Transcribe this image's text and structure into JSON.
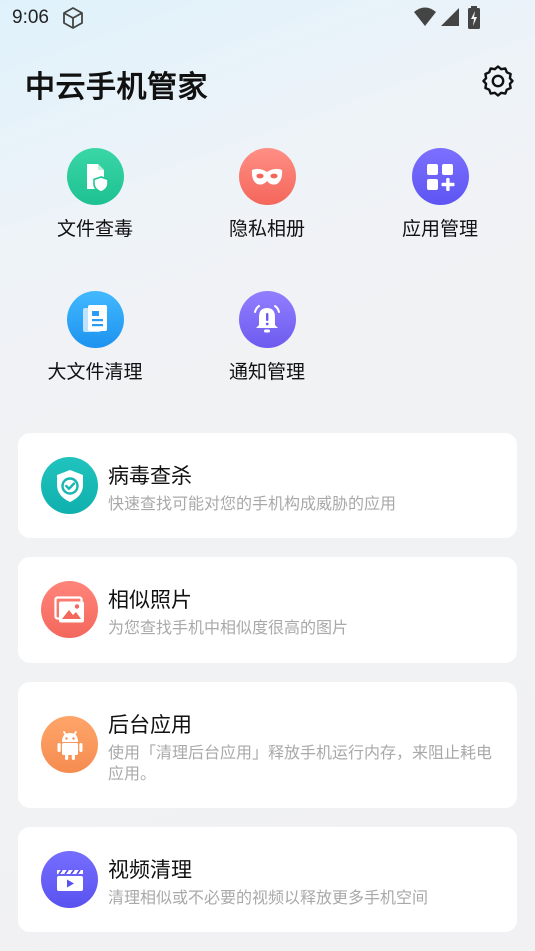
{
  "status_bar": {
    "time": "9:06",
    "icons": [
      "cube-icon",
      "wifi-icon",
      "signal-icon",
      "battery-charging-icon"
    ]
  },
  "header": {
    "title": "中云手机管家",
    "settings_icon": "gear-icon"
  },
  "quick_actions": [
    {
      "label": "文件查毒",
      "icon": "file-shield-icon",
      "color_from": "#34d3a0",
      "color_to": "#1dbf8e"
    },
    {
      "label": "隐私相册",
      "icon": "mask-icon",
      "color_from": "#ff8a80",
      "color_to": "#f4655a"
    },
    {
      "label": "应用管理",
      "icon": "apps-add-icon",
      "color_from": "#7a6cff",
      "color_to": "#5f55f5"
    },
    {
      "label": "大文件清理",
      "icon": "document-icon",
      "color_from": "#3fb6ff",
      "color_to": "#1e93f0"
    },
    {
      "label": "通知管理",
      "icon": "bell-alert-icon",
      "color_from": "#8e7bff",
      "color_to": "#6f5cf0"
    }
  ],
  "cards": [
    {
      "title": "病毒查杀",
      "desc": "快速查找可能对您的手机构成威胁的应用",
      "icon": "shield-check-icon",
      "color": "#1bb9b5"
    },
    {
      "title": "相似照片",
      "desc": "为您查找手机中相似度很高的图片",
      "icon": "image-icon",
      "color": "#f6766c"
    },
    {
      "title": "后台应用",
      "desc": "使用「清理后台应用」释放手机运行内存，来阻止耗电应用。",
      "icon": "android-icon",
      "color": "#f89a5e"
    },
    {
      "title": "视频清理",
      "desc": "清理相似或不必要的视频以释放更多手机空间",
      "icon": "video-clapper-icon",
      "color": "#6c63f5"
    }
  ]
}
